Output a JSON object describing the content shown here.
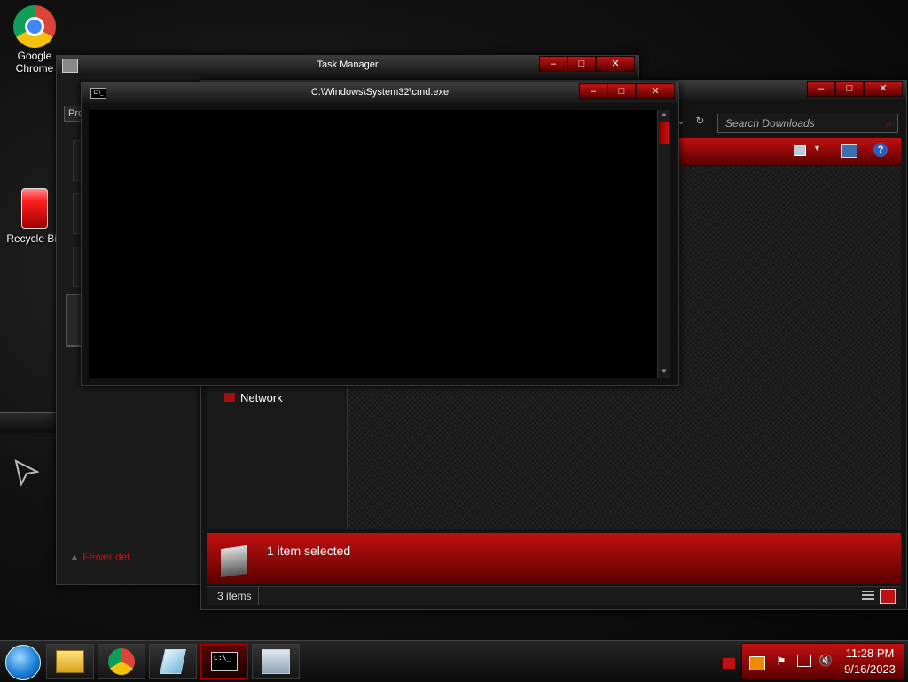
{
  "desktop": {
    "icons": [
      {
        "label": "Google Chrome",
        "icon": "chrome-icon"
      },
      {
        "label": "Recycle Bin",
        "icon": "recycle-bin-icon"
      }
    ]
  },
  "task_manager": {
    "title": "Task Manager",
    "tab_label": "Proc",
    "fewer_details": "Fewer det"
  },
  "cmd": {
    "title": "C:\\Windows\\System32\\cmd.exe",
    "icon_text": "C:\\_"
  },
  "explorer": {
    "search_placeholder": "Search Downloads",
    "nav_item": "Network",
    "details_text": "1 item selected",
    "status_text": "3 items"
  },
  "window_buttons": {
    "minimize": "–",
    "maximize": "□",
    "close": "✕"
  },
  "taskbar": {
    "items": [
      "start-orb-icon",
      "file-explorer-icon",
      "chrome-icon",
      "notes-icon",
      "cmd-icon",
      "task-manager-icon"
    ],
    "clock_time": "11:28 PM",
    "clock_date": "9/16/2023"
  },
  "colors": {
    "accent": "#c01010",
    "dark_accent": "#5a0000",
    "background": "#0a0a0a"
  }
}
